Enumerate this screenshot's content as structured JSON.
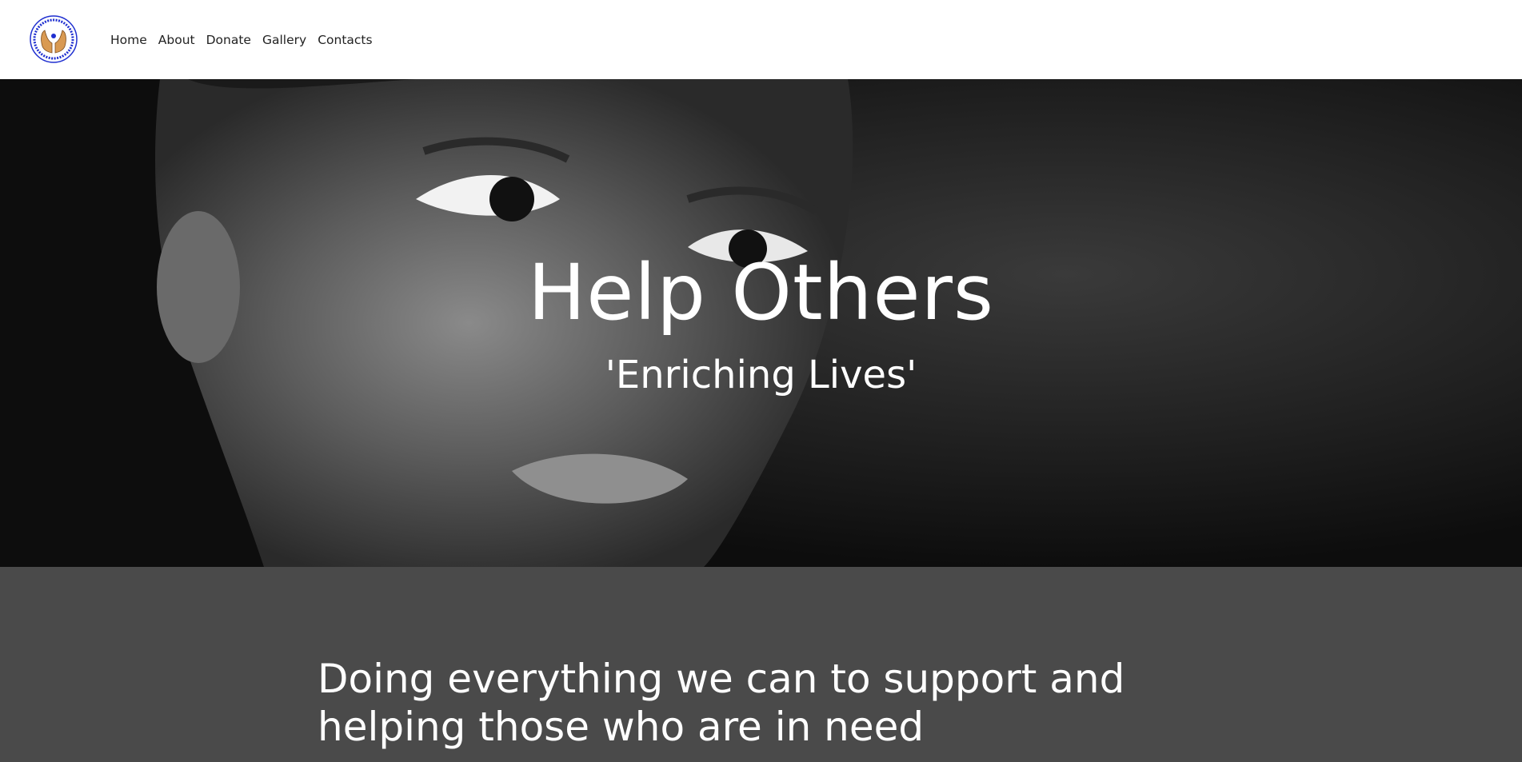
{
  "header": {
    "logo_text": "Help Others Enriching Lives",
    "nav": [
      {
        "label": "Home"
      },
      {
        "label": "About"
      },
      {
        "label": "Donate"
      },
      {
        "label": "Gallery"
      },
      {
        "label": "Contacts"
      }
    ]
  },
  "hero": {
    "title": "Help Others",
    "subtitle": "'Enriching Lives'"
  },
  "content": {
    "heading": "Doing everything we can to support and helping those who are in need"
  },
  "colors": {
    "header_bg": "#ffffff",
    "content_bg": "#4a4a4a",
    "hero_text": "#ffffff",
    "logo_ring": "#1f2fd0",
    "logo_hands": "#d99a52"
  }
}
